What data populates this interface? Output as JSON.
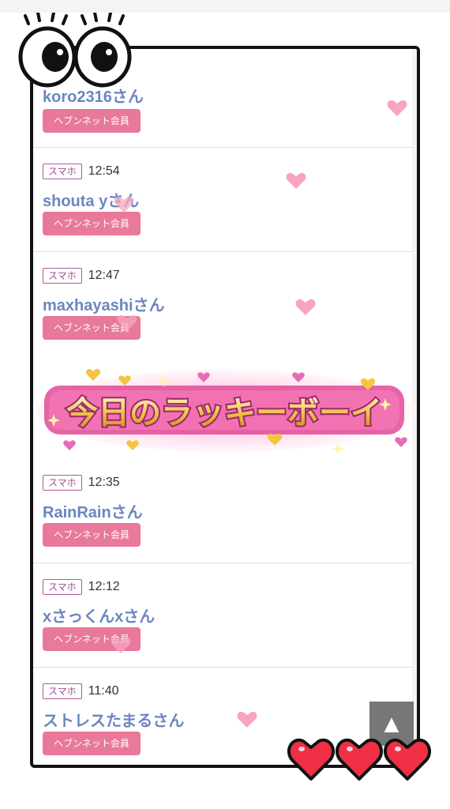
{
  "entries": [
    {
      "device": "",
      "time": "",
      "name": "koro2316さん",
      "member": "ヘブンネット会員"
    },
    {
      "device": "スマホ",
      "time": "12:54",
      "name": "shouta yさん",
      "member": "ヘブンネット会員"
    },
    {
      "device": "スマホ",
      "time": "12:47",
      "name": "maxhayashiさん",
      "member": "ヘブンネット会員"
    },
    {
      "device": "スマホ",
      "time": "12:35",
      "name": "RainRainさん",
      "member": "ヘブンネット会員"
    },
    {
      "device": "スマホ",
      "time": "12:12",
      "name": "xさっくんxさん",
      "member": "ヘブンネット会員"
    },
    {
      "device": "スマホ",
      "time": "11:40",
      "name": "ストレスたまるさん",
      "member": "ヘブンネット会員"
    }
  ],
  "banner": {
    "text": "今日のラッキーボーイ"
  },
  "scroll_top": {
    "icon": "up-triangle-icon",
    "symbol": "▲"
  },
  "colors": {
    "name_link": "#6a86c0",
    "member_badge": "#e8799a",
    "device_tag_border": "#b05aa0",
    "heart_pink": "#f7a5bf",
    "heart_red": "#ee2f45"
  }
}
